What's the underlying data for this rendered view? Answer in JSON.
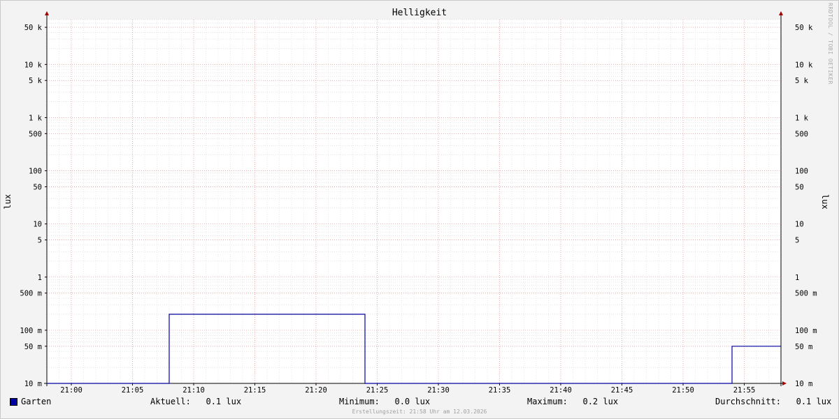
{
  "chart_data": {
    "type": "line",
    "title": "Helligkeit",
    "ylabel": "lux",
    "y_scale": "log",
    "ylim": [
      0.01,
      70000
    ],
    "y_ticks": [
      {
        "value": 50000,
        "label": "50 k"
      },
      {
        "value": 10000,
        "label": "10 k"
      },
      {
        "value": 5000,
        "label": "5 k"
      },
      {
        "value": 1000,
        "label": "1 k"
      },
      {
        "value": 500,
        "label": "500"
      },
      {
        "value": 100,
        "label": "100"
      },
      {
        "value": 50,
        "label": "50"
      },
      {
        "value": 10,
        "label": "10"
      },
      {
        "value": 5,
        "label": "5"
      },
      {
        "value": 1,
        "label": "1"
      },
      {
        "value": 0.5,
        "label": "500 m"
      },
      {
        "value": 0.1,
        "label": "100 m"
      },
      {
        "value": 0.05,
        "label": "50 m"
      },
      {
        "value": 0.01,
        "label": "10 m"
      }
    ],
    "x_range": [
      "20:58",
      "21:58"
    ],
    "x_ticks": [
      "21:00",
      "21:05",
      "21:10",
      "21:15",
      "21:20",
      "21:25",
      "21:30",
      "21:35",
      "21:40",
      "21:45",
      "21:50",
      "21:55"
    ],
    "grid": true,
    "series": [
      {
        "name": "Garten",
        "color": "#0000a0",
        "points": [
          {
            "x": "20:58",
            "y": 0.01
          },
          {
            "x": "21:08",
            "y": 0.01
          },
          {
            "x": "21:08",
            "y": 0.2
          },
          {
            "x": "21:24",
            "y": 0.2
          },
          {
            "x": "21:24",
            "y": 0.01
          },
          {
            "x": "21:54",
            "y": 0.01
          },
          {
            "x": "21:54",
            "y": 0.05
          },
          {
            "x": "21:58",
            "y": 0.05
          }
        ]
      }
    ]
  },
  "watermark": "RRDTOOL / TOBI OETIKER",
  "ylabel_right": "lux",
  "legend": {
    "series_name": "Garten",
    "current": "Aktuell:   0.1 lux",
    "minimum": "Minimum:   0.0 lux",
    "maximum": "Maximum:   0.2 lux",
    "average": "Durchschnitt:   0.1 lux"
  },
  "footer": "Erstellungszeit: 21:58 Uhr am 12.03.2026"
}
